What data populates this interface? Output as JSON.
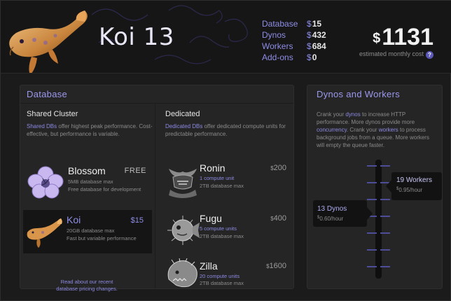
{
  "app": {
    "title": "Koi 13"
  },
  "summary": [
    {
      "label": "Database",
      "currency": "$",
      "value": "15"
    },
    {
      "label": "Dynos",
      "currency": "$",
      "value": "432"
    },
    {
      "label": "Workers",
      "currency": "$",
      "value": "684"
    },
    {
      "label": "Add-ons",
      "currency": "$",
      "value": "0"
    }
  ],
  "cost": {
    "currency": "$",
    "amount": "1131",
    "note": "estimated monthly cost",
    "help": "?"
  },
  "database": {
    "heading": "Database",
    "shared": {
      "title": "Shared Cluster",
      "desc_highlight": "Shared DBs",
      "desc_rest": " offer highest peak performance. Cost-effective, but performance is variable.",
      "plans": [
        {
          "name": "Blossom",
          "price": "FREE",
          "line1": "5MB database max",
          "line2": "Free database for development",
          "icon": "blossom-flower-icon"
        },
        {
          "name": "Koi",
          "price": "$15",
          "line1": "20GB database max",
          "line2": "Fast but variable performance",
          "icon": "koi-fish-icon"
        }
      ],
      "read_more_line1": "Read about our recent",
      "read_more_line2": "database pricing changes."
    },
    "dedicated": {
      "title": "Dedicated",
      "desc_highlight": "Dedicated DBs",
      "desc_rest": " offer dedicated compute units for predictable performance.",
      "plans": [
        {
          "name": "Ronin",
          "currency": "$",
          "price": "200",
          "units": "1 compute unit",
          "storage": "2TB database max",
          "icon": "ronin-helmet-icon"
        },
        {
          "name": "Fugu",
          "currency": "$",
          "price": "400",
          "units": "5 compute units",
          "storage": "2TB database max",
          "icon": "fugu-pufferfish-icon"
        },
        {
          "name": "Zilla",
          "currency": "$",
          "price": "1600",
          "units": "20 compute units",
          "storage": "2TB database max",
          "icon": "zilla-monster-icon"
        }
      ]
    }
  },
  "dynos_workers": {
    "heading": "Dynos and Workers",
    "desc": {
      "p1": "Crank your ",
      "hl1": "dynos",
      "p2": " to increase HTTP performance. More dynos provide more ",
      "hl2": "concurrency",
      "p3": ". Crank your ",
      "hl3": "workers",
      "p4": " to process background jobs from a queue. More workers will empty the queue faster."
    },
    "dynos": {
      "count": "13 Dynos",
      "rate_currency": "$",
      "rate": "0.60/hour"
    },
    "workers": {
      "count": "19 Workers",
      "rate_currency": "$",
      "rate": "0.95/hour"
    }
  }
}
